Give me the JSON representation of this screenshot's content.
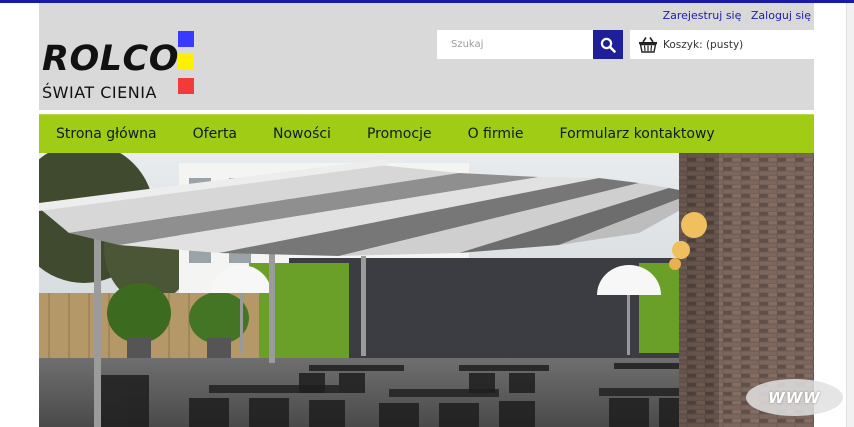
{
  "header": {
    "logo_title": "ROLCO",
    "logo_subtitle": "ŚWIAT CIENIA",
    "brand_colors": {
      "blue": "#3a3aff",
      "yellow": "#ffef00",
      "red": "#f33a3a"
    }
  },
  "auth": {
    "register": "Zarejestruj się",
    "login": "Zaloguj się"
  },
  "search": {
    "placeholder": "Szukaj",
    "icon": "search-icon"
  },
  "cart": {
    "label": "Koszyk: (pusty)",
    "icon": "basket-icon"
  },
  "menu": {
    "items": [
      {
        "label": "Strona główna"
      },
      {
        "label": "Oferta"
      },
      {
        "label": "Nowości"
      },
      {
        "label": "Promocje"
      },
      {
        "label": "O firmie"
      },
      {
        "label": "Formularz kontaktowy"
      }
    ]
  },
  "badge": {
    "label": "WWW"
  },
  "colors": {
    "accent": "#1f1f99",
    "menu_bg": "#a0cc16",
    "header_bg": "#d9d9d9"
  }
}
